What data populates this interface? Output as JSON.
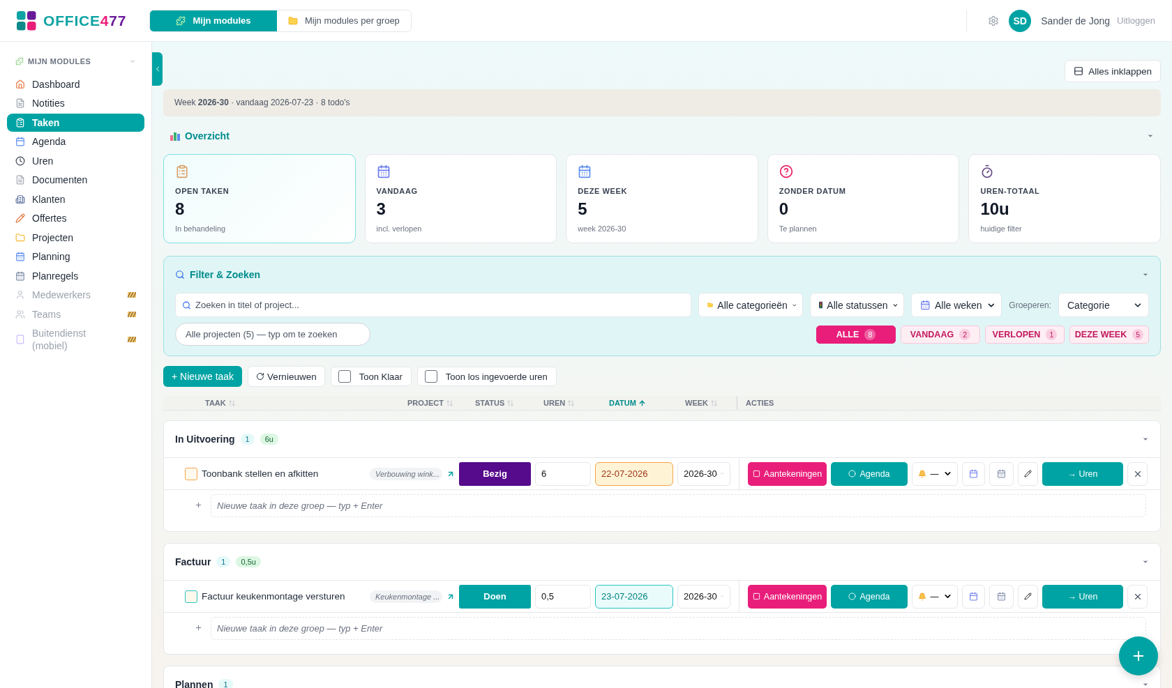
{
  "logo_parts": [
    {
      "text": "OFFICE",
      "color": "#0fa3a3"
    },
    {
      "text": "4",
      "color": "#e91e7a"
    },
    {
      "text": "77",
      "color": "#6a1b9a"
    }
  ],
  "top_tabs": [
    {
      "label": "Mijn modules",
      "selected": true
    },
    {
      "label": "Mijn modules per groep",
      "selected": false
    }
  ],
  "user": {
    "initials": "SD",
    "name": "Sander de Jong",
    "logout": "Uitloggen"
  },
  "sidebar": {
    "title": "MIJN MODULES",
    "items": [
      {
        "label": "Dashboard",
        "selected": false,
        "disabled": false
      },
      {
        "label": "Notities",
        "selected": false,
        "disabled": false
      },
      {
        "label": "Taken",
        "selected": true,
        "disabled": false
      },
      {
        "label": "Agenda",
        "selected": false,
        "disabled": false
      },
      {
        "label": "Uren",
        "selected": false,
        "disabled": false
      },
      {
        "label": "Documenten",
        "selected": false,
        "disabled": false
      },
      {
        "label": "Klanten",
        "selected": false,
        "disabled": false
      },
      {
        "label": "Offertes",
        "selected": false,
        "disabled": false
      },
      {
        "label": "Projecten",
        "selected": false,
        "disabled": false
      },
      {
        "label": "Planning",
        "selected": false,
        "disabled": false
      },
      {
        "label": "Planregels",
        "selected": false,
        "disabled": false
      },
      {
        "label": "Medewerkers",
        "selected": false,
        "disabled": true
      },
      {
        "label": "Teams",
        "selected": false,
        "disabled": true
      },
      {
        "label": "Buitendienst (mobiel)",
        "selected": false,
        "disabled": true
      }
    ]
  },
  "collapse_all": "Alles inklappen",
  "week_bar": "Week **2026-30** · vandaag 2026-07-23 · 8 todo's",
  "overview": {
    "title": "Overzicht",
    "cards": [
      {
        "label": "OPEN TAKEN",
        "value": "8",
        "sub": "In behandeling",
        "selected": true
      },
      {
        "label": "VANDAAG",
        "value": "3",
        "sub": "incl. verlopen",
        "selected": false
      },
      {
        "label": "DEZE WEEK",
        "value": "5",
        "sub": "week 2026-30",
        "selected": false
      },
      {
        "label": "ZONDER DATUM",
        "value": "0",
        "sub": "Te plannen",
        "selected": false
      },
      {
        "label": "UREN-TOTAAL",
        "value": "10u",
        "sub": "huidige filter",
        "selected": false
      }
    ]
  },
  "filter": {
    "title": "Filter & Zoeken",
    "search_placeholder": "Zoeken in titel of project...",
    "selects": [
      {
        "value": "Alle categorieën"
      },
      {
        "value": "Alle statussen"
      },
      {
        "value": "Alle weken"
      }
    ],
    "group_label": "Groeperen:",
    "group_value": "Categorie",
    "project_placeholder": "Alle projecten (5) — typ om te zoeken",
    "chips": [
      {
        "label": "ALLE",
        "count": "8",
        "selected": true
      },
      {
        "label": "VANDAAG",
        "count": "2",
        "selected": false
      },
      {
        "label": "VERLOPEN",
        "count": "1",
        "selected": false
      },
      {
        "label": "DEZE WEEK",
        "count": "5",
        "selected": false
      }
    ]
  },
  "toolbar": {
    "new_task": "+ Nieuwe taak",
    "refresh": "Vernieuwen",
    "toggles": [
      {
        "label": "Toon Klaar",
        "checked": false
      },
      {
        "label": "Toon los ingevoerde uren",
        "checked": false
      }
    ]
  },
  "columns": [
    {
      "label": "TAAK",
      "sortable": true,
      "sorted": false
    },
    {
      "label": "PROJECT",
      "sortable": true,
      "sorted": false
    },
    {
      "label": "STATUS",
      "sortable": true,
      "sorted": false
    },
    {
      "label": "UREN",
      "sortable": true,
      "sorted": false
    },
    {
      "label": "DATUM",
      "sortable": true,
      "sorted": true
    },
    {
      "label": "WEEK",
      "sortable": true,
      "sorted": false
    },
    {
      "label": "ACTIES",
      "sortable": false,
      "sorted": false
    }
  ],
  "groups": [
    {
      "name": "In Uitvoering",
      "count": "1",
      "hours": "6u",
      "new_placeholder": "Nieuwe taak in deze groep — typ + Enter",
      "tasks": [
        {
          "title": "Toonbank stellen en afkitten",
          "project": "Verbouwing wink...",
          "status": "Bezig",
          "color": "#560a8c",
          "hours": "6",
          "date": "22-07-2026",
          "overdue": true,
          "week": "2026-30",
          "notes": "Aantekeningen",
          "agenda": "Agenda",
          "reminder": "—",
          "hours_button": "→ Uren"
        }
      ]
    },
    {
      "name": "Factuur",
      "count": "1",
      "hours": "0,5u",
      "new_placeholder": "Nieuwe taak in deze groep — typ + Enter",
      "tasks": [
        {
          "title": "Factuur keukenmontage versturen",
          "project": "Keukenmontage ...",
          "status": "Doen",
          "color": "#00a3a3",
          "hours": "0,5",
          "date": "23-07-2026",
          "overdue": false,
          "week": "2026-30",
          "notes": "Aantekeningen",
          "agenda": "Agenda",
          "reminder": "—",
          "hours_button": "→ Uren"
        }
      ]
    },
    {
      "name": "Plannen",
      "count": "1"
    }
  ]
}
